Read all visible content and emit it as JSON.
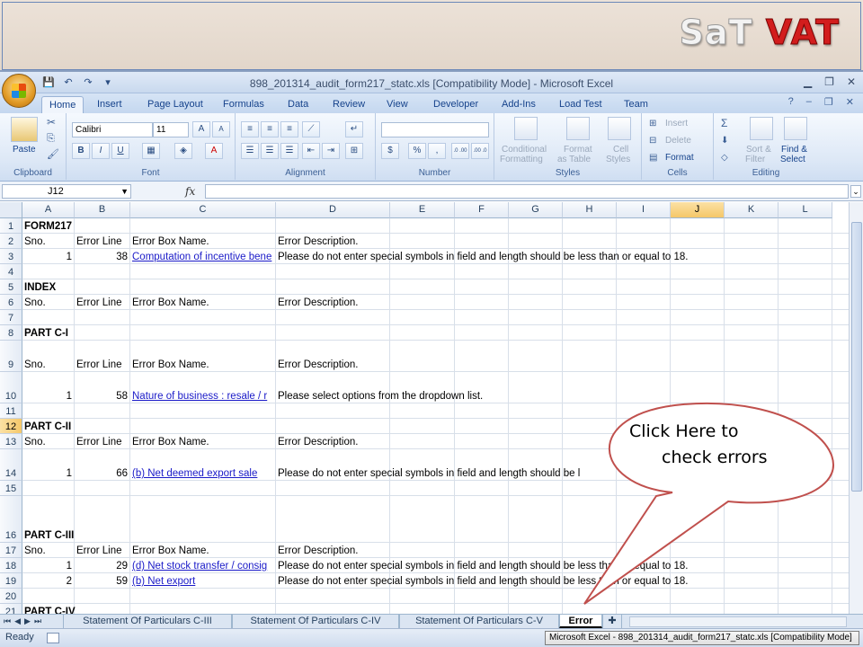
{
  "branding": {
    "logo_part1": "SaT",
    "logo_part2": "VAT"
  },
  "window": {
    "title": "898_201314_audit_form217_statc.xls  [Compatibility Mode] - Microsoft Excel",
    "minimize": "▁",
    "restore": "❐",
    "close": "✕"
  },
  "ribbon_tabs": [
    "Home",
    "Insert",
    "Page Layout",
    "Formulas",
    "Data",
    "Review",
    "View",
    "Developer",
    "Add-Ins",
    "Load Test",
    "Team"
  ],
  "ribbon": {
    "clipboard": {
      "label": "Clipboard",
      "paste": "Paste"
    },
    "font": {
      "label": "Font",
      "name": "Calibri",
      "size": "11",
      "bold": "B",
      "italic": "I",
      "underline": "U",
      "grow": "A",
      "shrink": "A"
    },
    "alignment": {
      "label": "Alignment"
    },
    "number": {
      "label": "Number",
      "currency": "$",
      "percent": "%",
      "comma": ",",
      "inc": ".0 .00",
      "dec": ".00 .0"
    },
    "styles": {
      "label": "Styles",
      "conditional1": "Conditional",
      "conditional2": "Formatting",
      "format_table1": "Format",
      "format_table2": "as Table",
      "cell_styles1": "Cell",
      "cell_styles2": "Styles"
    },
    "cells": {
      "label": "Cells",
      "insert": "Insert",
      "delete": "Delete",
      "format": "Format"
    },
    "editing": {
      "label": "Editing",
      "sort1": "Sort &",
      "sort2": "Filter",
      "find1": "Find &",
      "find2": "Select"
    }
  },
  "formula_bar": {
    "name_box": "J12",
    "fx": "fx",
    "formula": ""
  },
  "columns": [
    "A",
    "B",
    "C",
    "D",
    "E",
    "F",
    "G",
    "H",
    "I",
    "J",
    "K",
    "L"
  ],
  "selected_column": "J",
  "rows": [
    "1",
    "2",
    "3",
    "4",
    "5",
    "6",
    "7",
    "8",
    "9",
    "10",
    "11",
    "12",
    "13",
    "14",
    "15",
    "16",
    "17",
    "18",
    "19",
    "20",
    "21"
  ],
  "selected_row": "12",
  "cells": {
    "r1_a": "FORM217",
    "r2_a": "Sno.",
    "r2_b": "Error Line",
    "r2_c": "Error Box Name.",
    "r2_d": "Error Description.",
    "r3_a": "1",
    "r3_b": "38",
    "r3_c": "Computation of incentive bene",
    "r3_d": "Please do not enter special symbols in field and length should be less than or equal to 18.",
    "r5_a": "INDEX",
    "r6_a": "Sno.",
    "r6_b": "Error Line",
    "r6_c": "Error Box Name.",
    "r6_d": "Error Description.",
    "r8_a": "PART C-I",
    "r9_a": "Sno.",
    "r9_b": "Error Line",
    "r9_c": "Error Box Name.",
    "r9_d": "Error Description.",
    "r10_a": "1",
    "r10_b": "58",
    "r10_c": "Nature of business : resale / r",
    "r10_d": "Please select options from the dropdown list.",
    "r12_a": "PART C-II",
    "r13_a": "Sno.",
    "r13_b": "Error Line",
    "r13_c": "Error Box Name.",
    "r13_d": "Error Description.",
    "r14_a": "1",
    "r14_b": "66",
    "r14_c": "(b) Net deemed export sale",
    "r14_d": "Please do not enter special symbols in field and length should be l",
    "r16_a": "PART C-III",
    "r17_a": "Sno.",
    "r17_b": "Error Line",
    "r17_c": "Error Box Name.",
    "r17_d": "Error Description.",
    "r18_a": "1",
    "r18_b": "29",
    "r18_c": "(d) Net stock transfer / consig",
    "r18_d": "Please do not enter special symbols in field and length should be less than or equal to 18.",
    "r19_a": "2",
    "r19_b": "59",
    "r19_c": "(b) Net export",
    "r19_d": "Please do not enter special symbols in field and length should be less than or equal to 18.",
    "r21_a": "PART C-IV"
  },
  "sheet_tabs": [
    "Statement Of Particulars C-III",
    "Statement Of Particulars C-IV",
    "Statement Of Particulars C-V",
    "Error"
  ],
  "active_sheet": "Error",
  "status": {
    "ready": "Ready",
    "taskbar": "Microsoft Excel - 898_201314_audit_form217_statc.xls  [Compatibility Mode]"
  },
  "callout": {
    "line1": "Click Here to",
    "line2": "check errors"
  },
  "colors": {
    "callout_stroke": "#c0504d",
    "link": "#1a1ac8",
    "selected_header": "#f5c768"
  }
}
